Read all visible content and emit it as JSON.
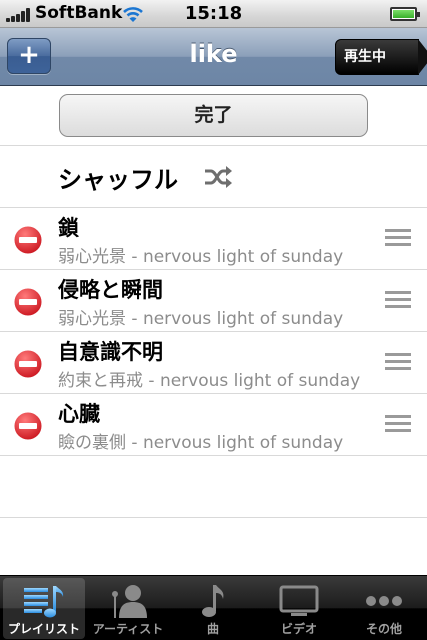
{
  "status_bar": {
    "carrier": "SoftBank",
    "time": "15:18"
  },
  "nav": {
    "title": "like",
    "add_label": "+",
    "now_playing_label": "再生中"
  },
  "edit": {
    "done_label": "完了"
  },
  "shuffle": {
    "label": "シャッフル"
  },
  "songs": [
    {
      "title": "鎖",
      "subtitle": "弱心光景 - nervous light of sunday"
    },
    {
      "title": "侵略と瞬間",
      "subtitle": "弱心光景 - nervous light of sunday"
    },
    {
      "title": "自意識不明",
      "subtitle": "約束と再戒 - nervous light of sunday"
    },
    {
      "title": "心臓",
      "subtitle": "瞼の裏側 - nervous light of sunday"
    }
  ],
  "tabs": [
    {
      "label": "プレイリスト",
      "icon": "playlist-icon",
      "selected": true
    },
    {
      "label": "アーティスト",
      "icon": "artist-icon",
      "selected": false
    },
    {
      "label": "曲",
      "icon": "song-icon",
      "selected": false
    },
    {
      "label": "ビデオ",
      "icon": "video-icon",
      "selected": false
    },
    {
      "label": "その他",
      "icon": "more-icon",
      "selected": false
    }
  ]
}
